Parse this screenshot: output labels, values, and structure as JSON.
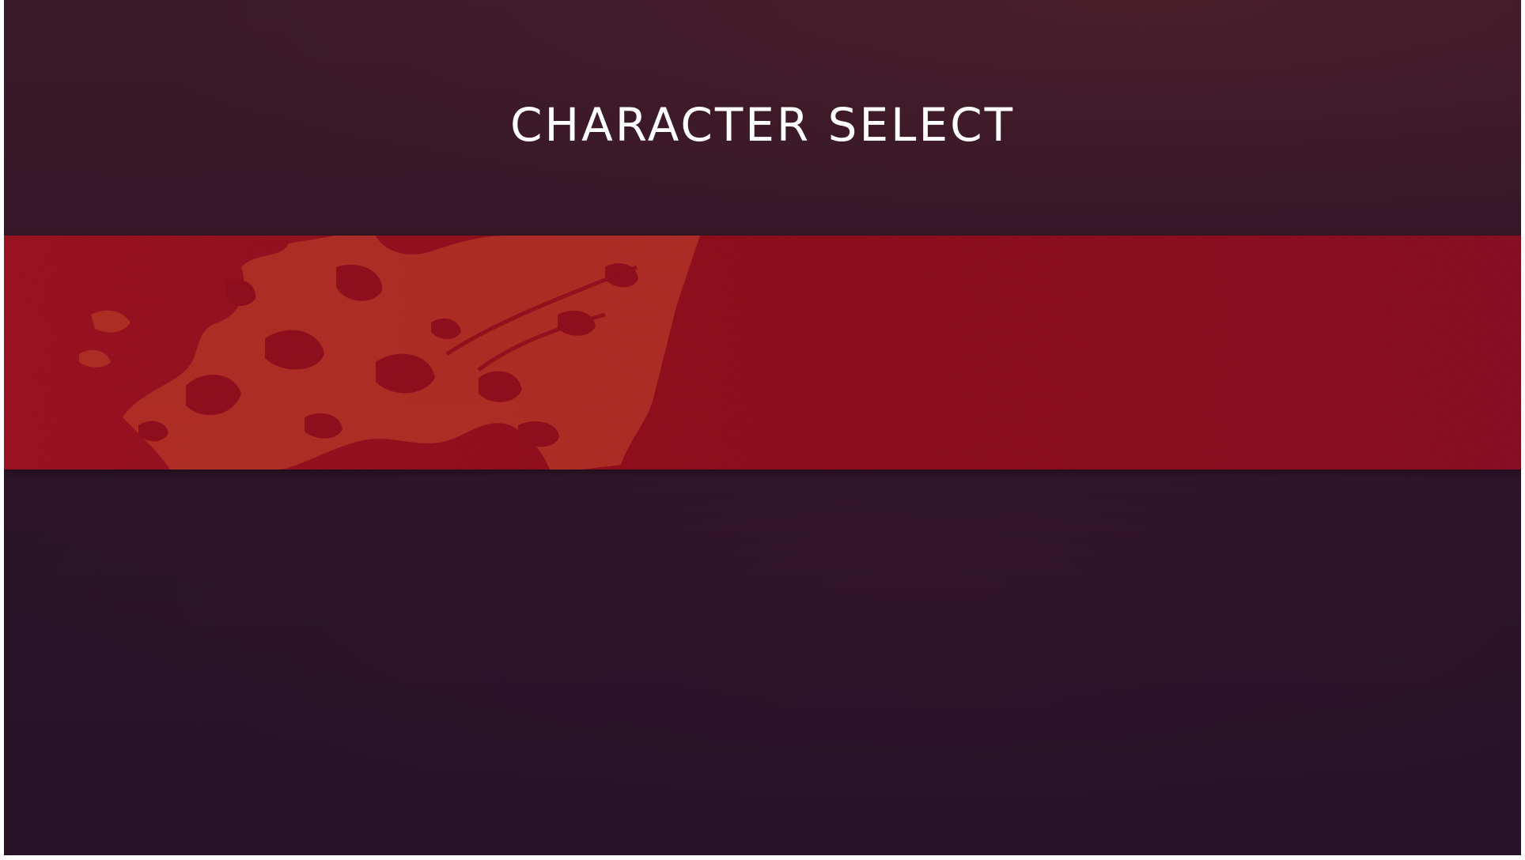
{
  "screen": {
    "title": "CHARACTER SELECT"
  },
  "theme": {
    "background_top": "#3a1a29",
    "background_bottom": "#271228",
    "banner_color": "#8f0614",
    "splatter_color": "#b8301e",
    "title_color": "#ffffff"
  },
  "banner": {
    "texture": "paint-splatter-decoration"
  }
}
